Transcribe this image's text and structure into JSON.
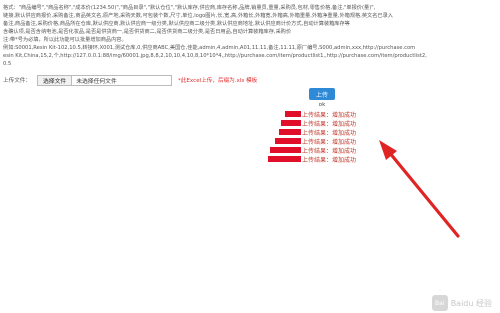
{
  "info": {
    "lines": [
      "格式：\"商品编号\",\"商品名称\",\"成本价(1234.50)\",\"商品目录\",\"默认仓位\",\"默认库存,供应商,库存名称,品牌,销量员,重量,采购员,包材,零售价格,备注,\"单报价(量)\",",
      "链接,默认供应商报价,采购备注,商品英文名,原产地,采购天数,可包装个数,尺寸,单位,logo图片,长,宽,高,外箱长,外箱宽,外箱高,外箱重量,外箱净重量,外箱规格,英文名已录入",
      "备注,商品备注,采购价格,商品所在仓库,默认供应商,默认供应商一级分类,默认供应商二级分类,默认供应商地址,默认供应商计价方式,自动计算装箱库存等",
      "含确认项,是否含纳电池,是否化妆品,是否是供货商一,是否供货商二,是否供货商二级分类,是否日用品,自动计算装箱库存,采购价",
      "注:带*号为必填，所以此功能可以批量增加商品内容。",
      "例如:S0001,Resin Kit-102,10.5,转接环,X001,测试仓库,0,供应商ABC,美国仓,佳能,admin,4,admin,A01,11.11,备注,11.11,原厂编号,S000,admin,xxx,http://purchase.com",
      "esin Kit,China,15,2,个,http://127.0.0.1:88/img/60001.jpg,8,8,2,10,10,4,10,8,10*10*4,,http://purchase.com/item/productlist1,,http://purchase.com/item/productlist2,",
      "0.5"
    ]
  },
  "upload": {
    "label": "上传文件：",
    "choose_button": "选择文件",
    "file_status": "未选择任何文件",
    "hint": "*此Excel上传，后缀为.xls 模板",
    "submit": "上传",
    "ok": "ok"
  },
  "results": [
    {
      "text": "上传结果：增加成功"
    },
    {
      "text": "上传结果：增加成功"
    },
    {
      "text": "上传结果：增加成功"
    },
    {
      "text": "上传结果：增加成功"
    },
    {
      "text": "上传结果：增加成功"
    },
    {
      "text": "上传结果：增加成功"
    }
  ],
  "watermark": {
    "logo_glyph": "Bai",
    "text": "Baidu 经验"
  },
  "colors": {
    "accent_red": "#e03030",
    "redaction": "#e0102a",
    "arrow": "#e02424",
    "button_blue": "#2e8ad6"
  }
}
